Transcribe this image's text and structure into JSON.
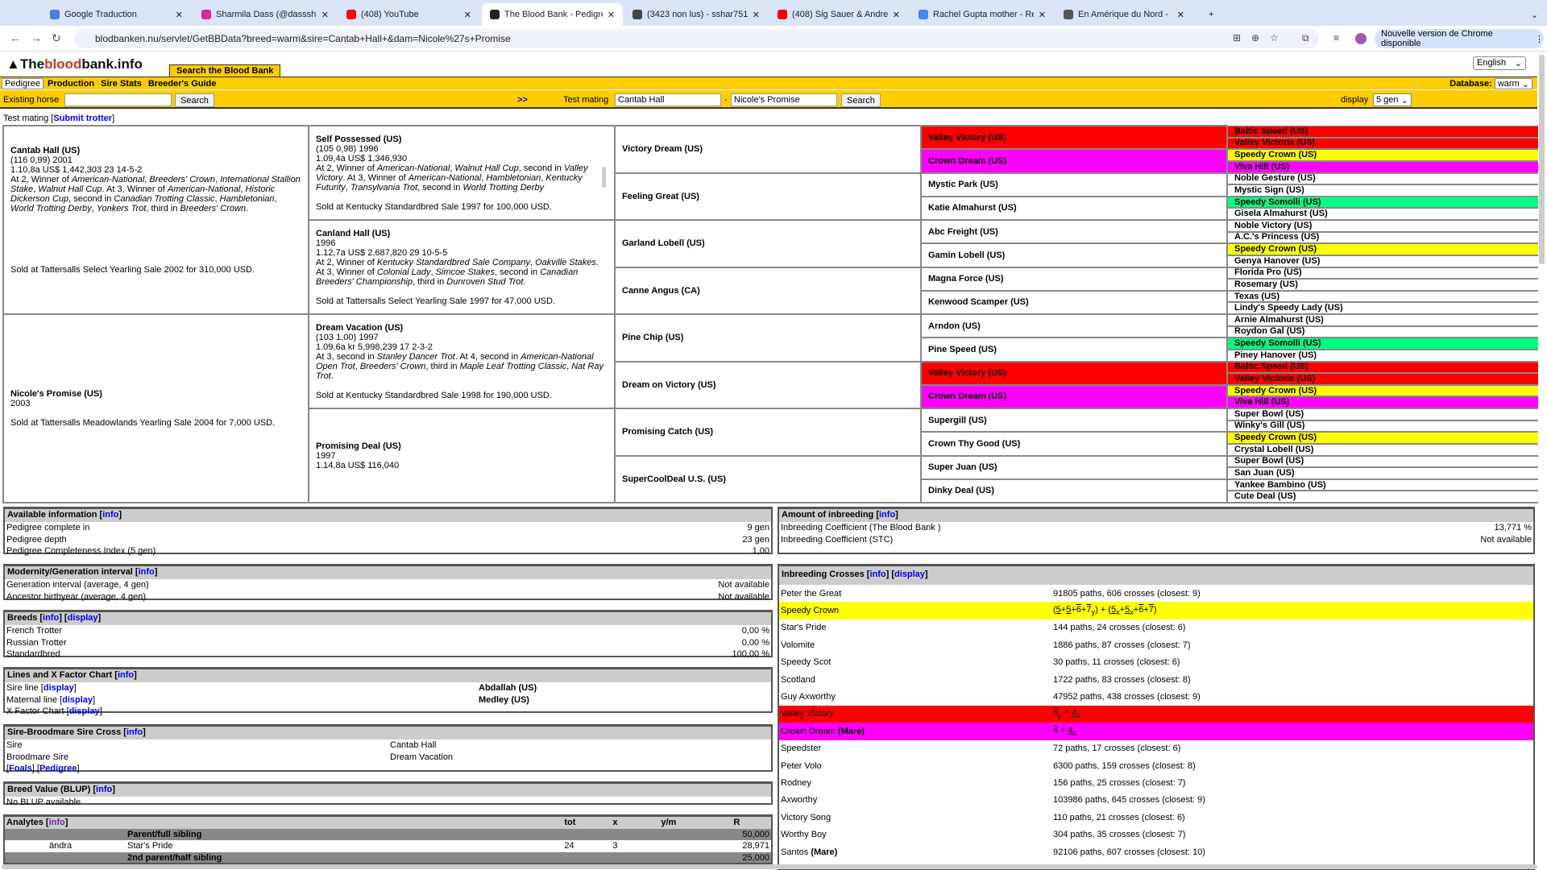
{
  "browser": {
    "tabs": [
      {
        "title": "Google Traduction",
        "color": "#4a7ae8"
      },
      {
        "title": "Sharmila Dass (@dasssharmi",
        "color": "#d6249f"
      },
      {
        "title": "(408) YouTube",
        "color": "#ff0000"
      },
      {
        "title": "The Blood Bank - Pedigree",
        "color": "#222222",
        "active": true
      },
      {
        "title": "(3423 non lus) - sshar75116",
        "color": "#444444"
      },
      {
        "title": "(408) Sig Sauer & Andrew",
        "color": "#ff0000"
      },
      {
        "title": "Rachel Gupta mother - Reche",
        "color": "#4285f4"
      },
      {
        "title": "En Amérique du Nord -",
        "color": "#555555"
      }
    ],
    "url": "blodbanken.nu/servlet/GetBBData?breed=warm&sire=Cantab+Hall+&dam=Nicole%27s+Promise",
    "update_label": "Nouvelle version de Chrome disponible"
  },
  "site": {
    "logo_pre": "The",
    "logo_mid": "blood",
    "logo_post": "bank.info",
    "search_tab": "Search the Blood Bank",
    "language": "English",
    "menu": [
      "Pedigree",
      "Production",
      "Sire Stats",
      "Breeder's Guide"
    ],
    "database_label": "Database:",
    "database_value": "warm",
    "existing_horse_label": "Existing horse",
    "existing_horse_value": "",
    "search_label": "Search",
    "arrows": ">>",
    "test_mating_label": "Test mating",
    "sire_value": "Cantab Hall",
    "dash": "-",
    "dam_value": "Nicole's Promise",
    "display_label": "display",
    "display_value": "5 gen",
    "test_mating_line": "Test mating [",
    "submit_trotter": "Submit trotter",
    "close_bracket": "]"
  },
  "colors": {
    "valley_victory": "#ff0000",
    "crown_dream": "#ff00ff",
    "speedy_crown": "#ffff00",
    "speedy_somolli": "#00ff80",
    "nav": "#ffcc00"
  },
  "pedigree": {
    "gen1": [
      {
        "name": "Cantab Hall (US)",
        "lines": [
          "(116 0,99) 2001",
          "1.10,8a US$ 1,442,303 23 14-5-2"
        ],
        "record": [
          "At 2, Winner of ",
          {
            "i": "American-National"
          },
          ", ",
          {
            "i": "Breeders' Crown"
          },
          ", ",
          {
            "i": "International Stallion Stake"
          },
          ", ",
          {
            "i": "Walnut Hall Cup"
          },
          ". At 3, Winner of ",
          {
            "i": "American-National"
          },
          ", ",
          {
            "i": "Historic Dickerson Cup"
          },
          ", second in ",
          {
            "i": "Canadian Trotting Classic"
          },
          ", ",
          {
            "i": "Hambletonian"
          },
          ", ",
          {
            "i": "World Trotting Derby"
          },
          ", ",
          {
            "i": "Yonkers Trot"
          },
          ", third in ",
          {
            "i": "Breeders' Crown"
          },
          "."
        ],
        "sale": "Sold at Tattersalls Select Yearling Sale 2002 for 310,000 USD."
      },
      {
        "name": "Nicole's Promise (US)",
        "lines": [
          "2003"
        ],
        "record": [],
        "sale": "Sold at Tattersalls Meadowlands Yearling Sale 2004 for 7,000 USD."
      }
    ],
    "gen2": [
      {
        "name": "Self Possessed (US)",
        "lines": [
          "(105 0,98) 1996",
          "1.09,4a US$ 1,346,930"
        ],
        "record": [
          "At 2, Winner of ",
          {
            "i": "American-National"
          },
          ", ",
          {
            "i": "Walnut Hall Cup"
          },
          ", second in ",
          {
            "i": "Valley Victory"
          },
          ". At 3, Winner of ",
          {
            "i": "American-National"
          },
          ", ",
          {
            "i": "Hambletonian"
          },
          ", ",
          {
            "i": "Kentucky Futurity"
          },
          ", ",
          {
            "i": "Transylvania Trot"
          },
          ", second in ",
          {
            "i": "World Trotting Derby"
          }
        ],
        "scroll": true,
        "sale": "Sold at Kentucky Standardbred Sale 1997 for 100,000 USD."
      },
      {
        "name": "Canland Hall (US)",
        "lines": [
          "1996",
          "1.12,7a US$ 2,687,820 29 10-5-5"
        ],
        "record": [
          "At 2, Winner of ",
          {
            "i": "Kentucky Standardbred Sale Company"
          },
          ", ",
          {
            "i": "Oakville Stakes"
          },
          ". At 3, Winner of ",
          {
            "i": "Colonial Lady"
          },
          ", ",
          {
            "i": "Simcoe Stakes"
          },
          ", second in ",
          {
            "i": "Canadian Breeders' Championship"
          },
          ", third in ",
          {
            "i": "Dunroven Stud Trot"
          },
          "."
        ],
        "sale": "Sold at Tattersalls Select Yearling Sale 1997 for 47,000 USD."
      },
      {
        "name": "Dream Vacation (US)",
        "lines": [
          "(103 1,00) 1997",
          "1.09,6a kr 5,998,239 17 2-3-2"
        ],
        "record": [
          "At 3, second in ",
          {
            "i": "Stanley Dancer Trot"
          },
          ". At 4, second in ",
          {
            "i": "American-National Open Trot"
          },
          ", ",
          {
            "i": "Breeders' Crown"
          },
          ", third in ",
          {
            "i": "Maple Leaf Trotting Classic"
          },
          ", ",
          {
            "i": "Nat Ray Trot"
          },
          "."
        ],
        "sale": "Sold at Kentucky Standardbred Sale 1998 for 190,000 USD."
      },
      {
        "name": "Promising Deal (US)",
        "lines": [
          "1997",
          "1.14,8a US$ 116,040"
        ],
        "record": [],
        "sale": ""
      }
    ],
    "gen3": [
      "Victory Dream (US)",
      "Feeling Great (US)",
      "Garland Lobell (US)",
      "Canne Angus (CA)",
      "Pine Chip (US)",
      "Dream on Victory (US)",
      "Promising Catch (US)",
      "SuperCoolDeal U.S. (US)"
    ],
    "gen4": [
      {
        "n": "Valley Victory (US)",
        "c": "valley_victory"
      },
      {
        "n": "Crown Dream (US)",
        "c": "crown_dream"
      },
      {
        "n": "Mystic Park (US)"
      },
      {
        "n": "Katie Almahurst (US)"
      },
      {
        "n": "Abc Freight (US)"
      },
      {
        "n": "Gamin Lobell (US)"
      },
      {
        "n": "Magna Force (US)"
      },
      {
        "n": "Kenwood Scamper (US)"
      },
      {
        "n": "Arndon (US)"
      },
      {
        "n": "Pine Speed (US)"
      },
      {
        "n": "Valley Victory (US)",
        "c": "valley_victory"
      },
      {
        "n": "Crown Dream (US)",
        "c": "crown_dream"
      },
      {
        "n": "Supergill (US)"
      },
      {
        "n": "Crown Thy Good (US)"
      },
      {
        "n": "Super Juan (US)"
      },
      {
        "n": "Dinky Deal (US)"
      }
    ],
    "gen5": [
      {
        "n": "Baltic Speed (US)",
        "c": "valley_victory"
      },
      {
        "n": "Valley Victoria (US)",
        "c": "valley_victory"
      },
      {
        "n": "Speedy Crown (US)",
        "c": "speedy_crown"
      },
      {
        "n": "Viva Hill (US)",
        "c": "crown_dream"
      },
      {
        "n": "Noble Gesture (US)"
      },
      {
        "n": "Mystic Sign (US)"
      },
      {
        "n": "Speedy Somolli (US)",
        "c": "speedy_somolli"
      },
      {
        "n": "Gisela Almahurst (US)"
      },
      {
        "n": "Noble Victory (US)"
      },
      {
        "n": "A.C.'s Princess (US)"
      },
      {
        "n": "Speedy Crown (US)",
        "c": "speedy_crown"
      },
      {
        "n": "Genya Hanover (US)"
      },
      {
        "n": "Florida Pro (US)"
      },
      {
        "n": "Rosemary (US)"
      },
      {
        "n": "Texas (US)"
      },
      {
        "n": "Lindy's Speedy Lady (US)"
      },
      {
        "n": "Arnie Almahurst (US)"
      },
      {
        "n": "Roydon Gal (US)"
      },
      {
        "n": "Speedy Somolli (US)",
        "c": "speedy_somolli"
      },
      {
        "n": "Piney Hanover (US)"
      },
      {
        "n": "Baltic Speed (US)",
        "c": "valley_victory"
      },
      {
        "n": "Valley Victoria (US)",
        "c": "valley_victory"
      },
      {
        "n": "Speedy Crown (US)",
        "c": "speedy_crown"
      },
      {
        "n": "Viva Hill (US)",
        "c": "crown_dream"
      },
      {
        "n": "Super Bowl (US)"
      },
      {
        "n": "Winky's Gill (US)"
      },
      {
        "n": "Speedy Crown (US)",
        "c": "speedy_crown"
      },
      {
        "n": "Crystal Lobell (US)"
      },
      {
        "n": "Super Bowl (US)"
      },
      {
        "n": "San Juan (US)"
      },
      {
        "n": "Yankee Bambino (US)"
      },
      {
        "n": "Cute Deal (US)"
      }
    ]
  },
  "panels": {
    "info": "info",
    "display": "display",
    "available": {
      "title": "Available information",
      "rows": [
        [
          "Pedigree complete in",
          "9 gen"
        ],
        [
          "Pedigree depth",
          "23 gen"
        ],
        [
          "Pedigree Completeness Index (5 gen)",
          "1,00"
        ]
      ]
    },
    "modernity": {
      "title": "Modernity/Generation interval",
      "rows": [
        [
          "Generation interval (average, 4 gen)",
          "Not available"
        ],
        [
          "Ancestor birthyear (average, 4 gen)",
          "Not available"
        ]
      ]
    },
    "breeds": {
      "title": "Breeds",
      "rows": [
        [
          "French Trotter",
          "0,00 %"
        ],
        [
          "Russian Trotter",
          "0,00 %"
        ],
        [
          "Standardbred",
          "100,00 %"
        ]
      ]
    },
    "lines": {
      "title": "Lines and X Factor Chart",
      "rows": [
        [
          "Sire line",
          "Abdallah (US)"
        ],
        [
          "Maternal line",
          "Medley (US)"
        ],
        [
          "X Factor Chart",
          ""
        ]
      ]
    },
    "sbs": {
      "title": "Sire-Broodmare Sire Cross",
      "rows": [
        [
          "Sire",
          "Cantab Hall"
        ],
        [
          "Broodmare Sire",
          "Dream Vacation"
        ]
      ],
      "foals": "Foals",
      "pedigree": "Pedigree"
    },
    "blup": {
      "title": "Breed Value (BLUP)",
      "text": "No BLUP available"
    },
    "analytes": {
      "title": "Analytes",
      "cols": [
        "tot",
        "x",
        "y/m",
        "R"
      ],
      "groups": [
        {
          "label": "Parent/full sibling",
          "r": "50,000",
          "rows": [
            {
              "img_alt": "ändra",
              "name": "Star's Pride",
              "tot": "24",
              "x": "3",
              "ym": "",
              "r": "28,971"
            }
          ]
        },
        {
          "label": "2nd parent/half sibling",
          "r": "25,000",
          "rows": []
        }
      ]
    },
    "amount": {
      "title": "Amount of inbreeding",
      "rows": [
        [
          "Inbreeding Coefficient (The Blood Bank )",
          "13,771 %"
        ],
        [
          "Inbreeding Coefficient (STC)",
          "Not available"
        ]
      ]
    },
    "crosses": {
      "title": "Inbreeding Crosses",
      "mare": "(Mare)",
      "rows": [
        {
          "name": "Peter the Great",
          "v": "91805 paths, 606 crosses (closest: 9)"
        },
        {
          "name": "Speedy Crown",
          "c": "speedy_crown",
          "f": [
            "(",
            {
              "t": "5",
              "u": 1
            },
            "+",
            {
              "t": "5",
              "u": 1
            },
            "+",
            {
              "t": "6",
              "o": 1
            },
            "+",
            {
              "t": "7",
              "o": 1,
              "s": "y"
            },
            ") + (",
            {
              "t": "5",
              "u": 1,
              "s": "x"
            },
            "+",
            {
              "t": "5",
              "u": 1,
              "s": "x"
            },
            "+",
            {
              "t": "6",
              "o": 1
            },
            "+",
            {
              "t": "7",
              "o": 1
            },
            ")"
          ]
        },
        {
          "name": "Star's Pride",
          "v": "144 paths, 24 crosses (closest: 6)"
        },
        {
          "name": "Volomite",
          "v": "1886 paths, 87 crosses (closest: 7)"
        },
        {
          "name": "Speedy Scot",
          "v": "30 paths, 11 crosses (closest: 6)"
        },
        {
          "name": "Scotland",
          "v": "1722 paths, 83 crosses (closest: 8)"
        },
        {
          "name": "Guy Axworthy",
          "v": "47952 paths, 438 crosses (closest: 9)"
        },
        {
          "name": "Valley Victory",
          "c": "valley_victory",
          "f": [
            {
              "t": "4",
              "o": 1,
              "s": "y"
            },
            " + ",
            {
              "t": "4",
              "u": 1,
              "s": "x"
            }
          ]
        },
        {
          "name": "Crown Dream",
          "mare": true,
          "c": "crown_dream",
          "f": [
            {
              "t": "4",
              "o": 1
            },
            " + ",
            {
              "t": "4",
              "u": 1,
              "s": "x"
            }
          ]
        },
        {
          "name": "Speedster",
          "v": "72 paths, 17 crosses (closest: 6)"
        },
        {
          "name": "Peter Volo",
          "v": "6300 paths, 159 crosses (closest: 8)"
        },
        {
          "name": "Rodney",
          "v": "156 paths, 25 crosses (closest: 7)"
        },
        {
          "name": "Axworthy",
          "v": "103986 paths, 645 crosses (closest: 9)"
        },
        {
          "name": "Victory Song",
          "v": "110 paths, 21 crosses (closest: 6)"
        },
        {
          "name": "Worthy Boy",
          "v": "304 paths, 35 crosses (closest: 7)"
        },
        {
          "name": "Santos",
          "mare": true,
          "v": "92106 paths, 607 crosses (closest: 10)"
        }
      ]
    }
  }
}
